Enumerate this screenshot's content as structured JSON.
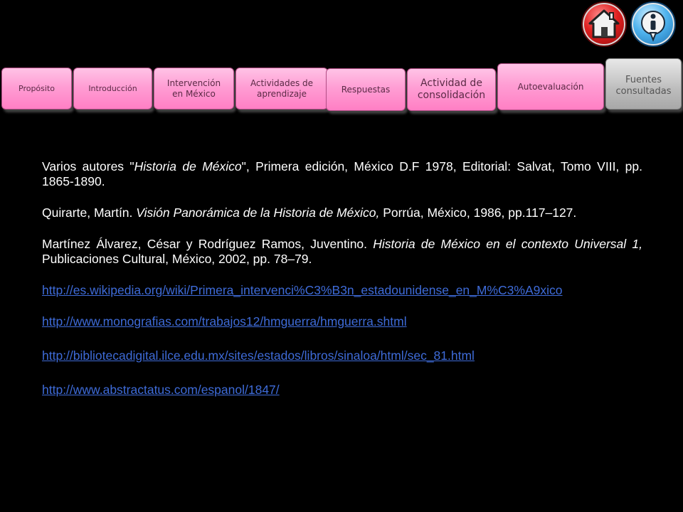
{
  "tabs": [
    {
      "label": "Propósito"
    },
    {
      "label": "Introducción"
    },
    {
      "label": "Intervención en México"
    },
    {
      "label": "Actividades de aprendizaje"
    },
    {
      "label": "Respuestas"
    },
    {
      "label": "Actividad de consolidación"
    },
    {
      "label": "Autoevaluación"
    },
    {
      "label": "Fuentes consultadas"
    }
  ],
  "buttons": {
    "home_icon": "home-icon",
    "info_icon": "info-icon"
  },
  "references": [
    {
      "pre": "Varios autores \"",
      "title": "Historia de México",
      "post": "\", Primera edición, México D.F 1978, Editorial: Salvat, Tomo VIII, pp. 1865-1890."
    },
    {
      "pre": "Quirarte, Martín. ",
      "title": "Visión Panorámica de la Historia de México,",
      "post": " Porrúa, México, 1986, pp.117–127."
    },
    {
      "pre": "Martínez Álvarez, César y Rodríguez Ramos, Juventino. ",
      "title": "Historia de México en el contexto Universal 1,",
      "post": " Publicaciones Cultural, México, 2002, pp. 78–79."
    }
  ],
  "links": [
    "http://es.wikipedia.org/wiki/Primera_intervenci%C3%B3n_estadounidense_en_M%C3%A9xico",
    "http://www.monografias.com/trabajos12/hmguerra/hmguerra.shtml",
    "http://bibliotecadigital.ilce.edu.mx/sites/estados/libros/sinaloa/html/sec_81.html",
    "http://www.abstractatus.com/espanol/1847/"
  ],
  "colors": {
    "tab": "#ff9ed4",
    "active_tab": "#bdbdbd",
    "link": "#3e6bd8",
    "background": "#000000"
  }
}
